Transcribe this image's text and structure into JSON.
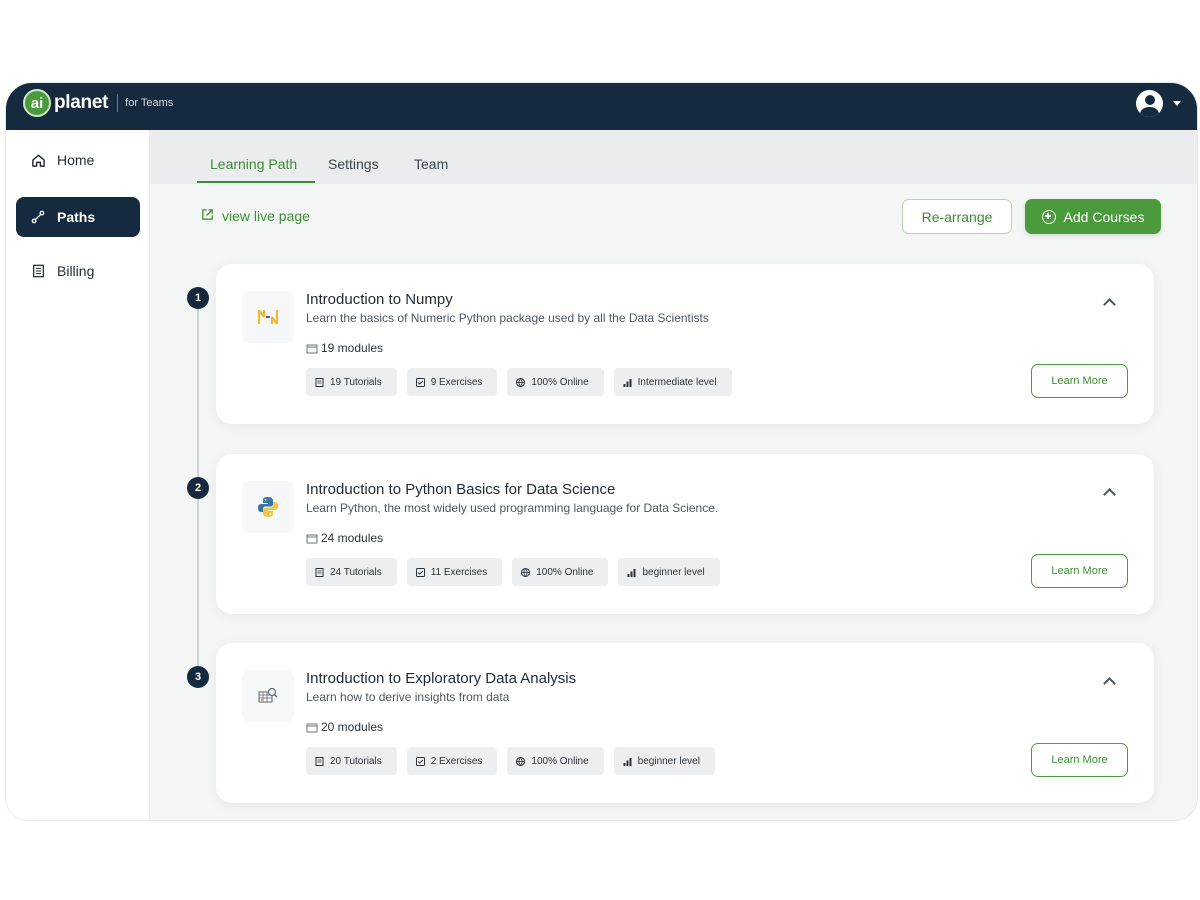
{
  "app": {
    "logo_badge": "ai",
    "logo_word": "planet",
    "logo_sub": "for Teams",
    "colors": {
      "navy": "#15293f",
      "green": "#4b9a3c",
      "green_text": "#3d8d35"
    }
  },
  "header": {
    "user_icon": "user-avatar-icon",
    "menu_icon": "caret-down-icon"
  },
  "sidebar": {
    "items": [
      {
        "label": "Home",
        "icon": "home-icon"
      },
      {
        "label": "Paths",
        "icon": "path-icon"
      },
      {
        "label": "Billing",
        "icon": "billing-icon"
      }
    ]
  },
  "tabs": [
    {
      "label": "Learning Path"
    },
    {
      "label": "Settings"
    },
    {
      "label": "Team"
    }
  ],
  "toolbar": {
    "live_link": "view live page",
    "rearrange": "Re-arrange",
    "add_courses": "Add Courses"
  },
  "courses": [
    {
      "step": "1",
      "title": "Introduction to Numpy",
      "desc": "Learn the basics of Numeric Python package used by all the Data Scientists",
      "modules": "19 modules",
      "tutorials": "19 Tutorials",
      "exercises": "9 Exercises",
      "online": "100% Online",
      "level": "Intermediate level",
      "button": "Learn More"
    },
    {
      "step": "2",
      "title": "Introduction to Python Basics for Data Science",
      "desc": "Learn Python, the most widely used programming language for Data Science.",
      "modules": "24 modules",
      "tutorials": "24 Tutorials",
      "exercises": "11 Exercises",
      "online": "100% Online",
      "level": "beginner level",
      "button": "Learn More"
    },
    {
      "step": "3",
      "title": "Introduction to Exploratory Data Analysis",
      "desc": "Learn how to derive insights from data",
      "modules": "20 modules",
      "tutorials": "20 Tutorials",
      "exercises": "2 Exercises",
      "online": "100% Online",
      "level": "beginner level",
      "button": "Learn More"
    }
  ]
}
